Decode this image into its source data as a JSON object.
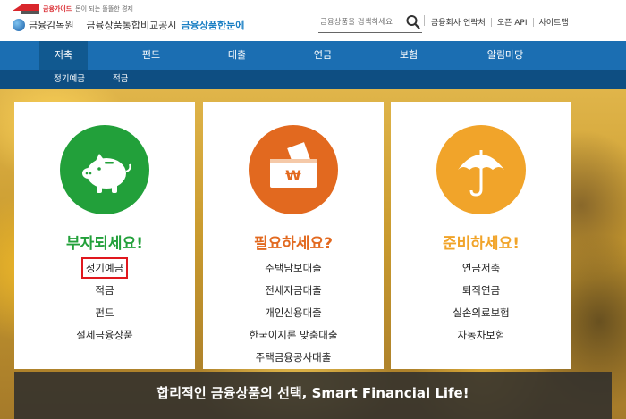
{
  "header": {
    "brand_mark": "금융가이드",
    "slogan": "돈이 되는 똘똘한 경제",
    "org": "금융감독원",
    "site_name": "금융상품통합비교공시",
    "service_name": "금융상품한눈에",
    "search": {
      "placeholder": "금융상품을 검색하세요",
      "icon": "search-icon"
    },
    "util_links": [
      "금융회사 연락처",
      "오픈 API",
      "사이트맵"
    ]
  },
  "nav": {
    "items": [
      "저축",
      "펀드",
      "대출",
      "연금",
      "보험",
      "알림마당"
    ],
    "active_index": 0,
    "sub_items": [
      "정기예금",
      "적금"
    ]
  },
  "cards": [
    {
      "title": "부자되세요!",
      "color": "#22a03a",
      "icon": "piggy-bank-icon",
      "links": [
        "정기예금",
        "적금",
        "펀드",
        "절세금융상품"
      ],
      "highlighted": 0
    },
    {
      "title": "필요하세요?",
      "color": "#e2691f",
      "icon": "won-wallet-icon",
      "links": [
        "주택담보대출",
        "전세자금대출",
        "개인신용대출",
        "한국이지론 맞춤대출",
        "주택금융공사대출"
      ],
      "highlighted": -1
    },
    {
      "title": "준비하세요!",
      "color": "#f1a42a",
      "icon": "umbrella-icon",
      "links": [
        "연금저축",
        "퇴직연금",
        "실손의료보험",
        "자동차보험"
      ],
      "highlighted": -1
    }
  ],
  "banner": {
    "text": "합리적인 금융상품의 선택, Smart Financial Life!"
  }
}
